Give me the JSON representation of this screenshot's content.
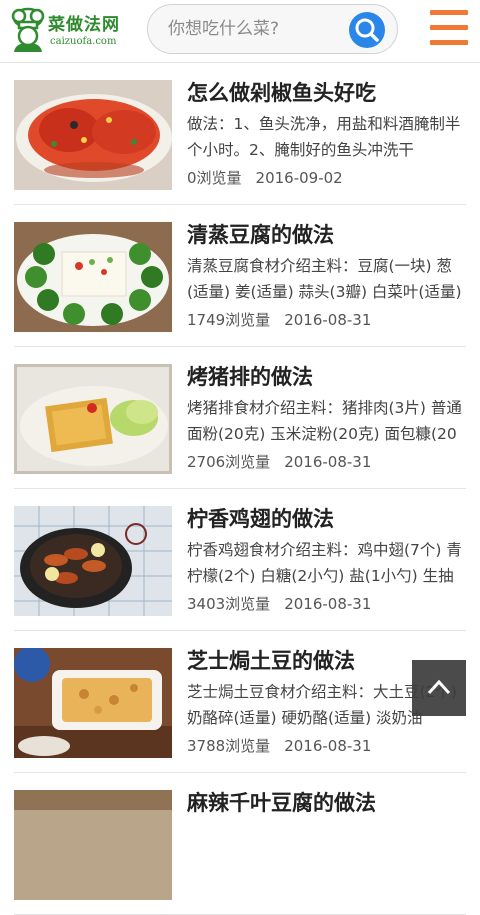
{
  "header": {
    "logo_title": "菜做法网",
    "logo_url_text": "caizuofa.com",
    "search_placeholder": "你想吃什么菜?"
  },
  "recipes": [
    {
      "title": "怎么做剁椒鱼头好吃",
      "desc": "做法：1、鱼头洗净，用盐和料酒腌制半个小时。2、腌制好的鱼头冲洗干",
      "views": "0浏览量",
      "date": "2016-09-02"
    },
    {
      "title": "清蒸豆腐的做法",
      "desc": "清蒸豆腐食材介绍主料：豆腐(一块) 葱(适量) 姜(适量) 蒜头(3瓣) 白菜叶(适量)",
      "views": "1749浏览量",
      "date": "2016-08-31"
    },
    {
      "title": "烤猪排的做法",
      "desc": "烤猪排食材介绍主料：猪排肉(3片) 普通面粉(20克) 玉米淀粉(20克) 面包糠(20",
      "views": "2706浏览量",
      "date": "2016-08-31"
    },
    {
      "title": "柠香鸡翅的做法",
      "desc": "柠香鸡翅食材介绍主料：鸡中翅(7个) 青柠檬(2个) 白糖(2小勺) 盐(1小勺) 生抽(2",
      "views": "3403浏览量",
      "date": "2016-08-31"
    },
    {
      "title": "芝士焗土豆的做法",
      "desc": "芝士焗土豆食材介绍主料：大土豆(2个) 奶酪碎(适量) 硬奶酪(适量) 淡奶油",
      "views": "3788浏览量",
      "date": "2016-08-31"
    },
    {
      "title": "麻辣千叶豆腐的做法",
      "desc": "",
      "views": "",
      "date": ""
    }
  ]
}
